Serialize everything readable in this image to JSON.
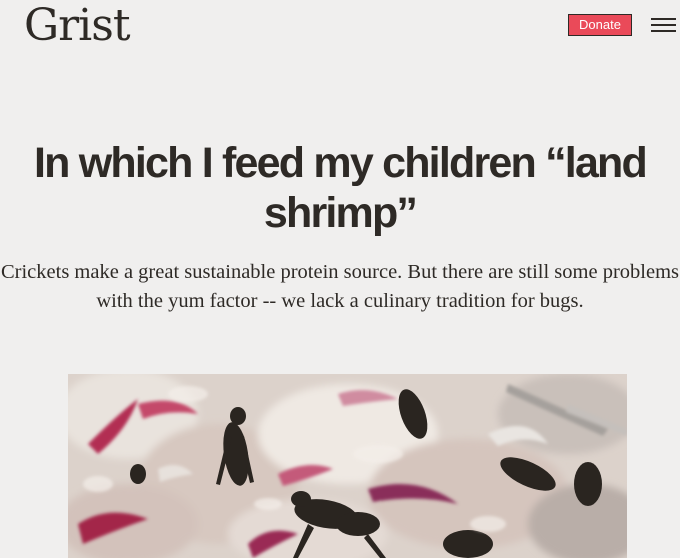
{
  "header": {
    "logo": "Grist",
    "donate_label": "Donate",
    "menu_icon": "hamburger-menu-icon"
  },
  "article": {
    "headline": "In which I feed my children “land shrimp”",
    "dek": "Crickets make a great sustainable protein source. But there are still some problems with the yum factor -- we lack a culinary tradition for bugs."
  },
  "colors": {
    "background": "#f0efee",
    "text": "#2e2a26",
    "donate_button": "#ea4a59"
  }
}
